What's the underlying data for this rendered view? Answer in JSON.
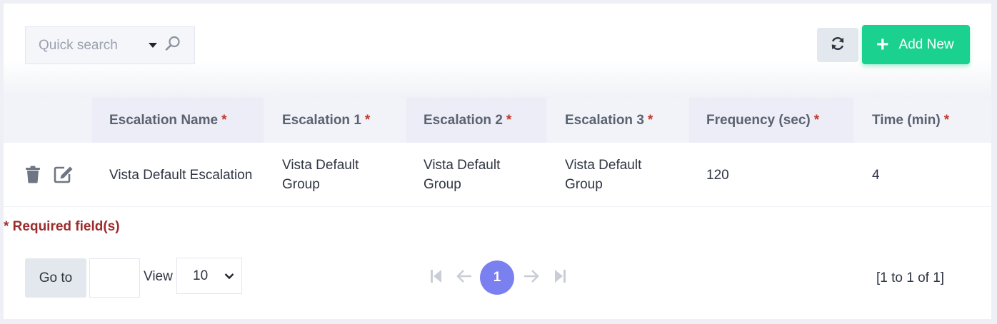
{
  "toolbar": {
    "search_placeholder": "Quick search",
    "add_new_label": "Add New",
    "add_new_icon": "+"
  },
  "table": {
    "columns": [
      {
        "label": "Escalation Name",
        "required_mark": "*"
      },
      {
        "label": "Escalation 1",
        "required_mark": "*"
      },
      {
        "label": "Escalation 2",
        "required_mark": "*"
      },
      {
        "label": "Escalation 3",
        "required_mark": "*"
      },
      {
        "label": "Frequency (sec)",
        "required_mark": "*"
      },
      {
        "label": "Time (min)",
        "required_mark": "*"
      }
    ],
    "rows": [
      {
        "name": "Vista Default Escalation",
        "escalation1": "Vista Default Group",
        "escalation2": "Vista Default Group",
        "escalation3": "Vista Default Group",
        "frequency": "120",
        "time": "4"
      }
    ],
    "required_note": "* Required field(s)"
  },
  "pagination": {
    "goto_label": "Go to",
    "view_label": "View",
    "page_size": "10",
    "current_page": "1",
    "range_text": "[1 to 1 of 1]"
  },
  "colors": {
    "accent_green": "#1bd18f",
    "page_active": "#7a80f0",
    "required_red": "#c0392b"
  }
}
